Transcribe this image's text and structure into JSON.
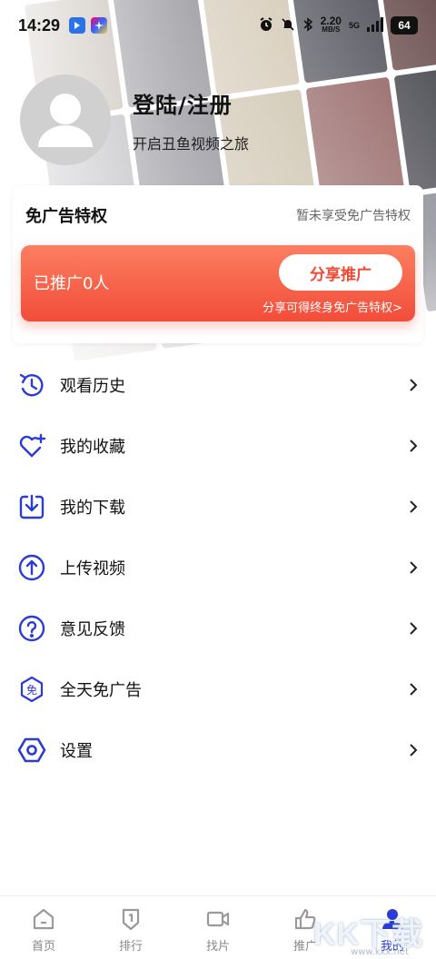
{
  "status_bar": {
    "time": "14:29",
    "speed_value": "2.20",
    "speed_unit": "MB/S",
    "network": "5G",
    "battery": "64"
  },
  "profile": {
    "title": "登陆/注册",
    "subtitle": "开启丑鱼视频之旅"
  },
  "adfree": {
    "title": "免广告特权",
    "status": "暂未享受免广告特权",
    "promo_count": "已推广0人",
    "share_label": "分享推广",
    "tip": "分享可得终身免广告特权>"
  },
  "menu": {
    "items": [
      {
        "label": "观看历史",
        "icon": "history-icon"
      },
      {
        "label": "我的收藏",
        "icon": "heart-plus-icon"
      },
      {
        "label": "我的下载",
        "icon": "download-icon"
      },
      {
        "label": "上传视频",
        "icon": "upload-icon"
      },
      {
        "label": "意见反馈",
        "icon": "question-icon"
      },
      {
        "label": "全天免广告",
        "icon": "ad-free-icon"
      },
      {
        "label": "设置",
        "icon": "settings-icon"
      }
    ]
  },
  "nav": {
    "items": [
      {
        "label": "首页",
        "icon": "home-icon"
      },
      {
        "label": "排行",
        "icon": "ranking-icon"
      },
      {
        "label": "找片",
        "icon": "video-camera-icon"
      },
      {
        "label": "推广",
        "icon": "thumbs-up-icon"
      },
      {
        "label": "我的",
        "icon": "user-icon",
        "active": true
      }
    ]
  },
  "watermark": {
    "text": "KK下载",
    "url": "www.kkx.net"
  },
  "colors": {
    "accent": "#2a3bd6",
    "promo_top": "#fb7e60",
    "promo_bottom": "#f24d3a",
    "nav_inactive": "#888888"
  }
}
